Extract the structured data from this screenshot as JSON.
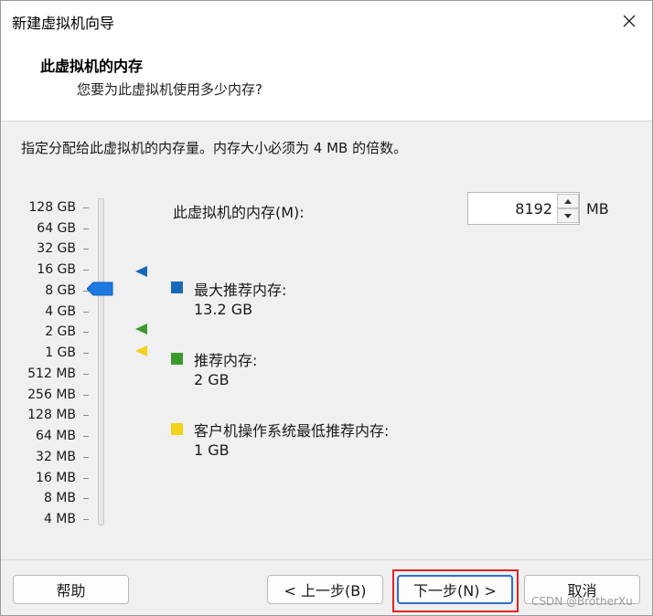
{
  "window": {
    "title": "新建虚拟机向导"
  },
  "header": {
    "title": "此虚拟机的内存",
    "subtitle": "您要为此虚拟机使用多少内存?"
  },
  "instruction": "指定分配给此虚拟机的内存量。内存大小必须为 4 MB 的倍数。",
  "scale": {
    "labels": [
      "128 GB",
      "64 GB",
      "32 GB",
      "16 GB",
      "8 GB",
      "4 GB",
      "2 GB",
      "1 GB",
      "512 MB",
      "256 MB",
      "128 MB",
      "64 MB",
      "32 MB",
      "16 MB",
      "8 MB",
      "4 MB"
    ],
    "selected": "8 GB"
  },
  "memory": {
    "label": "此虚拟机的内存(M):",
    "value": "8192",
    "unit": "MB"
  },
  "legend": {
    "max": {
      "label": "最大推荐内存:",
      "value": "13.2 GB",
      "color": "#1769b8"
    },
    "recommended": {
      "label": "推荐内存:",
      "value": "2 GB",
      "color": "#3a9a2a"
    },
    "guest_min": {
      "label": "客户机操作系统最低推荐内存:",
      "value": "1 GB",
      "color": "#f2d21a"
    }
  },
  "colors": {
    "thumb": "#1d79e0",
    "accent": "#2f6ed0",
    "highlight": "#e02424"
  },
  "buttons": {
    "help": "帮助",
    "back": "< 上一步(B)",
    "next": "下一步(N) >",
    "cancel": "取消"
  },
  "watermark": "CSDN @BrotherXu"
}
